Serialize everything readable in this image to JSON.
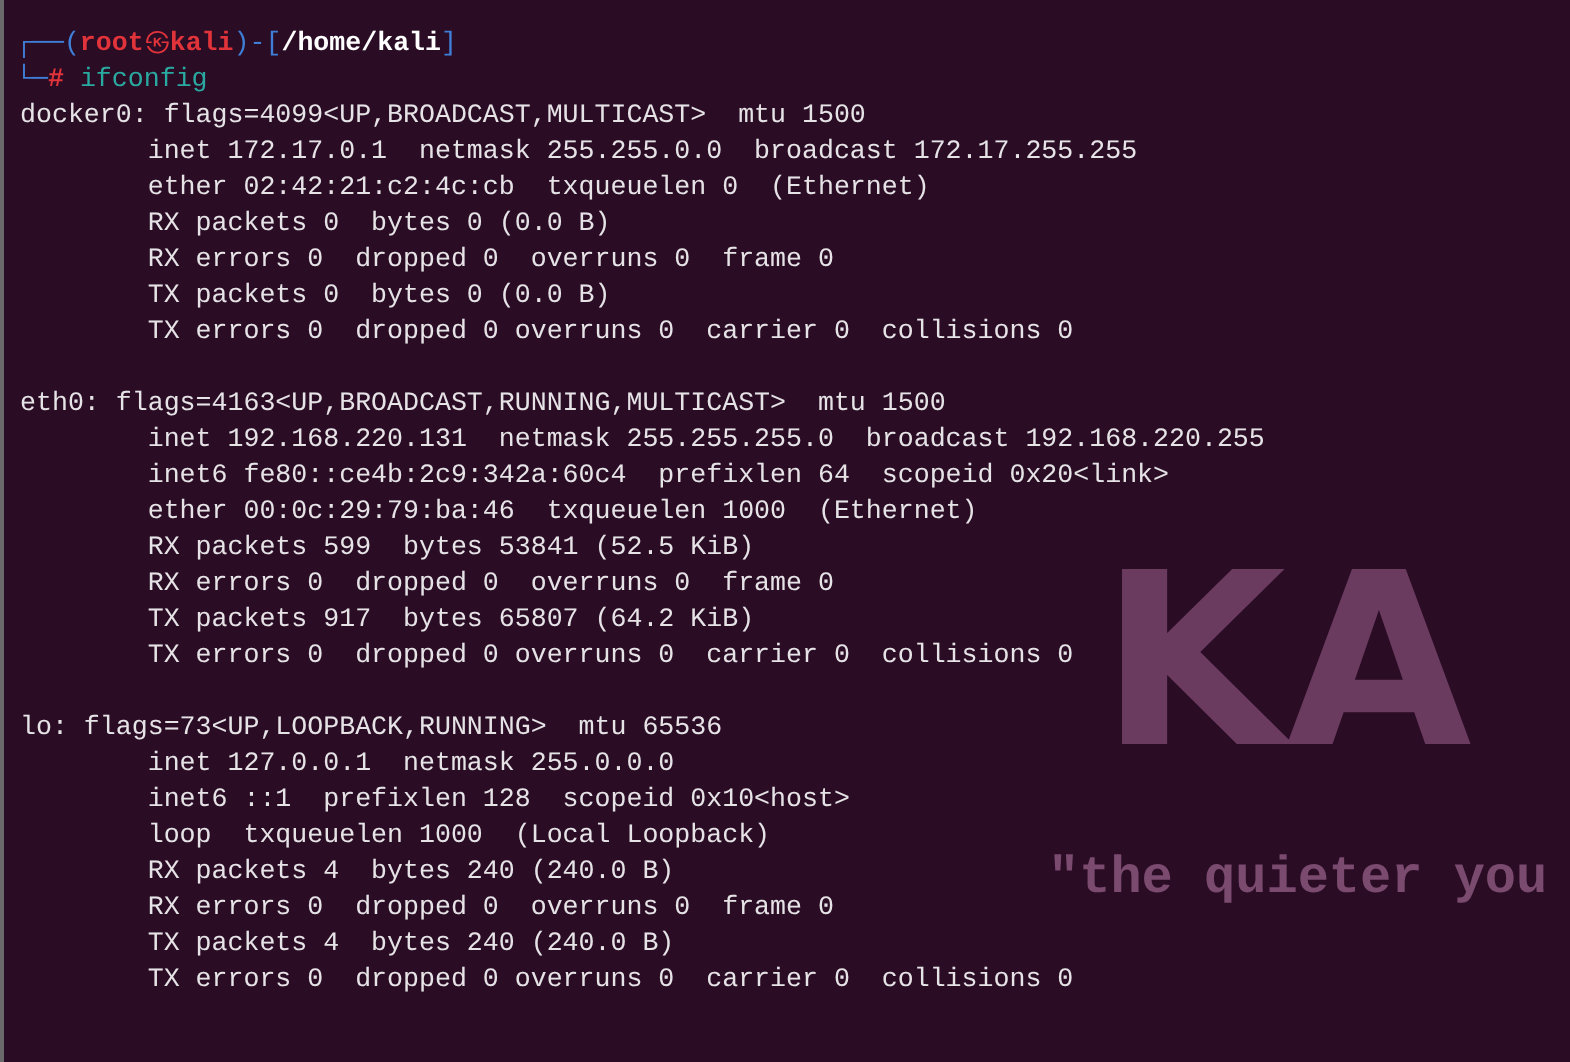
{
  "prompt": {
    "open": "┌──(",
    "user": "root",
    "at": "㉿",
    "host": "kali",
    "mid": ")-[",
    "path": "/home/kali",
    "close": "]",
    "corner": "└─",
    "symbol": "#",
    "command": "ifconfig"
  },
  "interfaces": [
    {
      "lines": [
        "docker0: flags=4099<UP,BROADCAST,MULTICAST>  mtu 1500",
        "        inet 172.17.0.1  netmask 255.255.0.0  broadcast 172.17.255.255",
        "        ether 02:42:21:c2:4c:cb  txqueuelen 0  (Ethernet)",
        "        RX packets 0  bytes 0 (0.0 B)",
        "        RX errors 0  dropped 0  overruns 0  frame 0",
        "        TX packets 0  bytes 0 (0.0 B)",
        "        TX errors 0  dropped 0 overruns 0  carrier 0  collisions 0"
      ]
    },
    {
      "lines": [
        "eth0: flags=4163<UP,BROADCAST,RUNNING,MULTICAST>  mtu 1500",
        "        inet 192.168.220.131  netmask 255.255.255.0  broadcast 192.168.220.255",
        "        inet6 fe80::ce4b:2c9:342a:60c4  prefixlen 64  scopeid 0x20<link>",
        "        ether 00:0c:29:79:ba:46  txqueuelen 1000  (Ethernet)",
        "        RX packets 599  bytes 53841 (52.5 KiB)",
        "        RX errors 0  dropped 0  overruns 0  frame 0",
        "        TX packets 917  bytes 65807 (64.2 KiB)",
        "        TX errors 0  dropped 0 overruns 0  carrier 0  collisions 0"
      ]
    },
    {
      "lines": [
        "lo: flags=73<UP,LOOPBACK,RUNNING>  mtu 65536",
        "        inet 127.0.0.1  netmask 255.0.0.0",
        "        inet6 ::1  prefixlen 128  scopeid 0x10<host>",
        "        loop  txqueuelen 1000  (Local Loopback)",
        "        RX packets 4  bytes 240 (240.0 B)",
        "        RX errors 0  dropped 0  overruns 0  frame 0",
        "        TX packets 4  bytes 240 (240.0 B)",
        "        TX errors 0  dropped 0 overruns 0  carrier 0  collisions 0"
      ]
    }
  ],
  "wallpaper": {
    "logo": "KA",
    "tagline": "\"the quieter you"
  }
}
